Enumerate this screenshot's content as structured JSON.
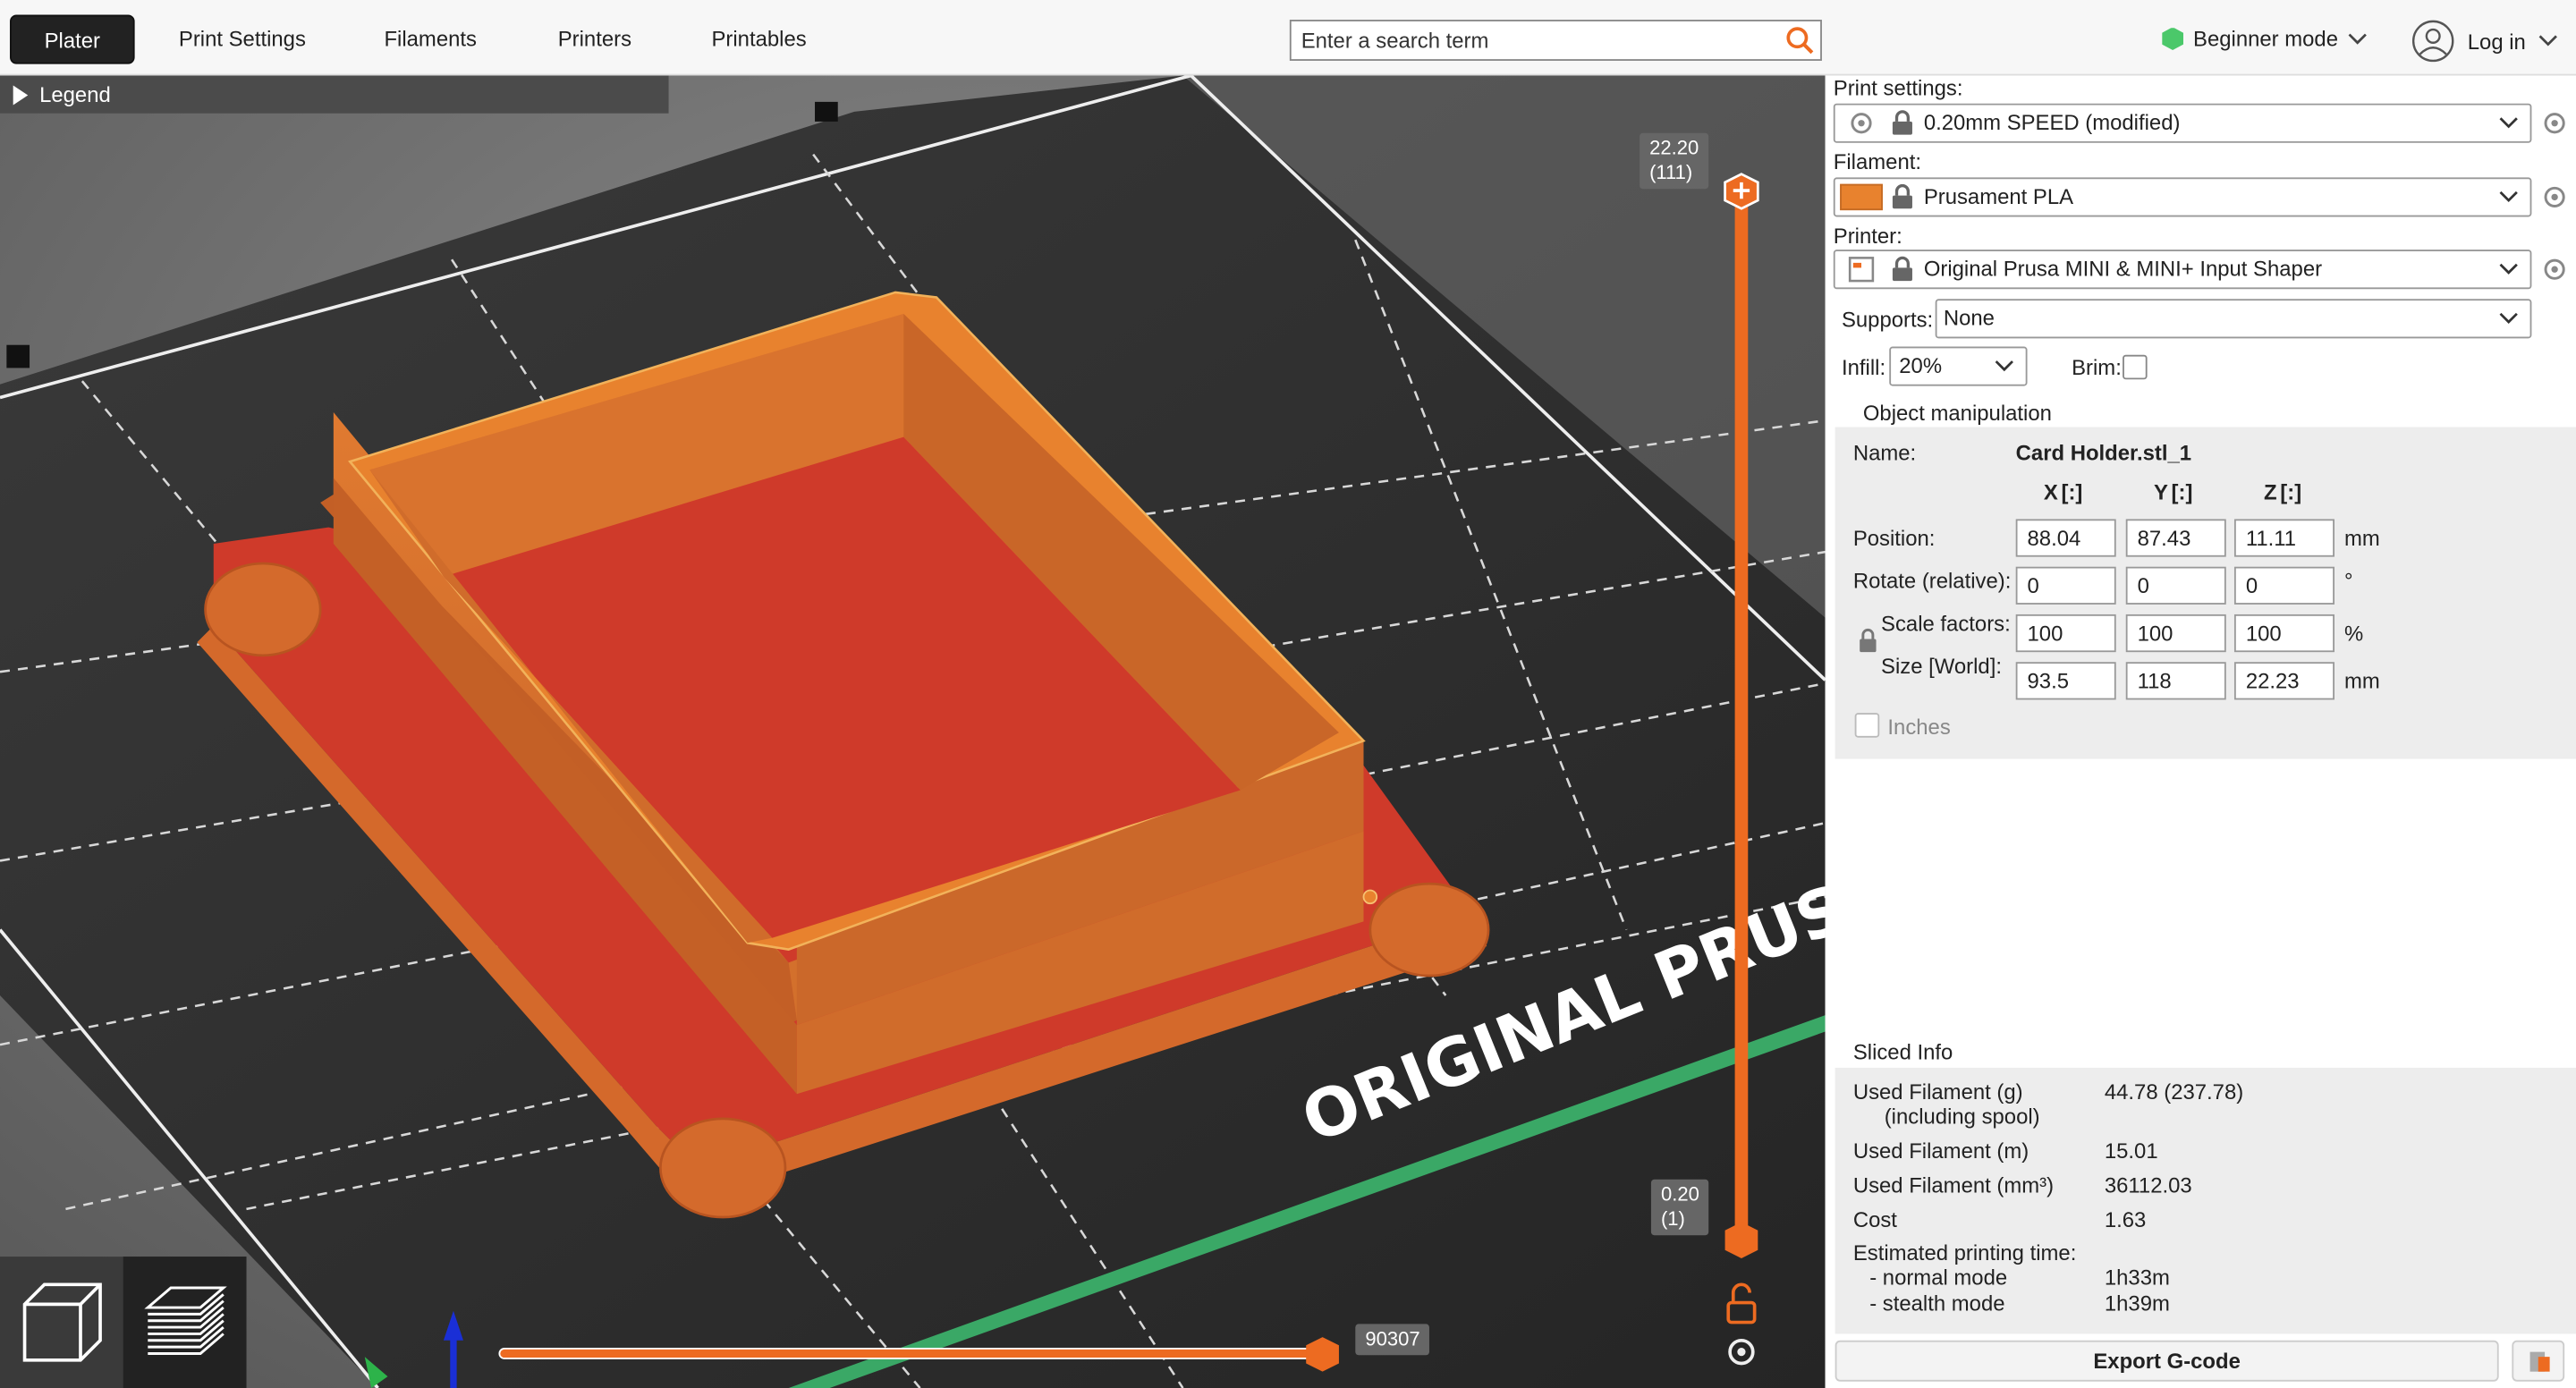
{
  "tabs": [
    {
      "label": "Plater",
      "active": true
    },
    {
      "label": "Print Settings"
    },
    {
      "label": "Filaments"
    },
    {
      "label": "Printers"
    },
    {
      "label": "Printables"
    }
  ],
  "search": {
    "placeholder": "Enter a search term"
  },
  "mode": {
    "label": "Beginner mode",
    "color": "#4bc86a"
  },
  "login": {
    "label": "Log in"
  },
  "legend": {
    "label": "Legend"
  },
  "vslider": {
    "top_value": "22.20",
    "top_layer": "(111)",
    "bottom_value": "0.20",
    "bottom_layer": "(1)"
  },
  "hslider": {
    "value": "90307"
  },
  "bed_text": "ORIGINAL PRUSA",
  "panel": {
    "print_settings_label": "Print settings:",
    "print_settings_value": "0.20mm SPEED (modified)",
    "filament_label": "Filament:",
    "filament_value": "Prusament PLA",
    "filament_color": "#e8822e",
    "printer_label": "Printer:",
    "printer_value": "Original Prusa MINI & MINI+ Input Shaper",
    "supports_label": "Supports:",
    "supports_value": "None",
    "infill_label": "Infill:",
    "infill_value": "20%",
    "brim_label": "Brim:"
  },
  "object_manipulation": {
    "title": "Object manipulation",
    "name_label": "Name:",
    "name_value": "Card Holder.stl_1",
    "axes": [
      "X",
      "Y",
      "Z"
    ],
    "rows": [
      {
        "label": "Position:",
        "values": [
          "88.04",
          "87.43",
          "11.11"
        ],
        "unit": "mm"
      },
      {
        "label": "Rotate (relative):",
        "values": [
          "0",
          "0",
          "0"
        ],
        "unit": "°"
      },
      {
        "label": "Scale factors:",
        "values": [
          "100",
          "100",
          "100"
        ],
        "unit": "%"
      },
      {
        "label": "Size [World]:",
        "values": [
          "93.5",
          "118",
          "22.23"
        ],
        "unit": "mm"
      }
    ],
    "inches_label": "Inches"
  },
  "sliced_info": {
    "title": "Sliced Info",
    "rows": [
      {
        "label": "Used Filament (g)",
        "sub": "(including spool)",
        "value": "44.78 (237.78)"
      },
      {
        "label": "Used Filament (m)",
        "value": "15.01"
      },
      {
        "label": "Used Filament (mm³)",
        "value": "36112.03"
      },
      {
        "label": "Cost",
        "value": "1.63"
      }
    ],
    "time_label": "Estimated printing time:",
    "normal_label": "- normal mode",
    "normal_value": "1h33m",
    "stealth_label": "- stealth mode",
    "stealth_value": "1h39m"
  },
  "export_label": "Export G-code",
  "colors": {
    "accent": "#ed6b21",
    "model_orange": "#e8822e",
    "model_red": "#cf3a2a",
    "bed": "#2b2b2b"
  }
}
